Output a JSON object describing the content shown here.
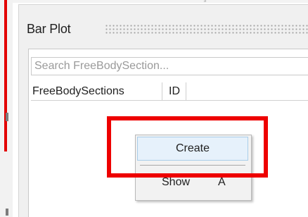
{
  "panel": {
    "title": "Bar Plot"
  },
  "search": {
    "placeholder": "Search FreeBodySection..."
  },
  "table": {
    "columns": [
      "FreeBodySections",
      "ID"
    ]
  },
  "context_menu": {
    "items": [
      {
        "label": "Create",
        "shortcut": ""
      },
      {
        "label": "Show",
        "shortcut": "A"
      }
    ]
  },
  "colors": {
    "highlight": "#ee0000",
    "menu_hover": "#e6f1fb",
    "panel_bg": "#f0f0f0"
  }
}
